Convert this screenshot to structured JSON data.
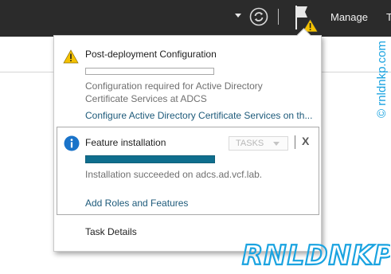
{
  "toolbar": {
    "manage_label": "Manage",
    "next_label": "T"
  },
  "notifications": {
    "post_deploy": {
      "title": "Post-deployment Configuration",
      "description": "Configuration required for Active Directory Certificate Services at ADCS",
      "link": "Configure Active Directory Certificate Services on th...",
      "progress": 0
    },
    "feature_install": {
      "title": "Feature installation",
      "tasks_label": "TASKS",
      "close_label": "X",
      "progress": 1.0,
      "description": "Installation succeeded on adcs.ad.vcf.lab.",
      "link": "Add Roles and Features"
    },
    "task_details_label": "Task Details"
  },
  "watermark": {
    "vertical_text": "© rnldnkp.com",
    "logo_text": "RNLDNKP"
  },
  "colors": {
    "topbar": "#2b2b2b",
    "link": "#1d5a7a",
    "progress_fill": "#0f6e8e",
    "warning": "#f5c200",
    "info": "#1a73c9",
    "watermark": "#1aa3e0"
  },
  "icons": {
    "refresh": "refresh-icon",
    "flag": "notification-flag-icon",
    "warning": "warning-icon",
    "info": "info-icon"
  }
}
